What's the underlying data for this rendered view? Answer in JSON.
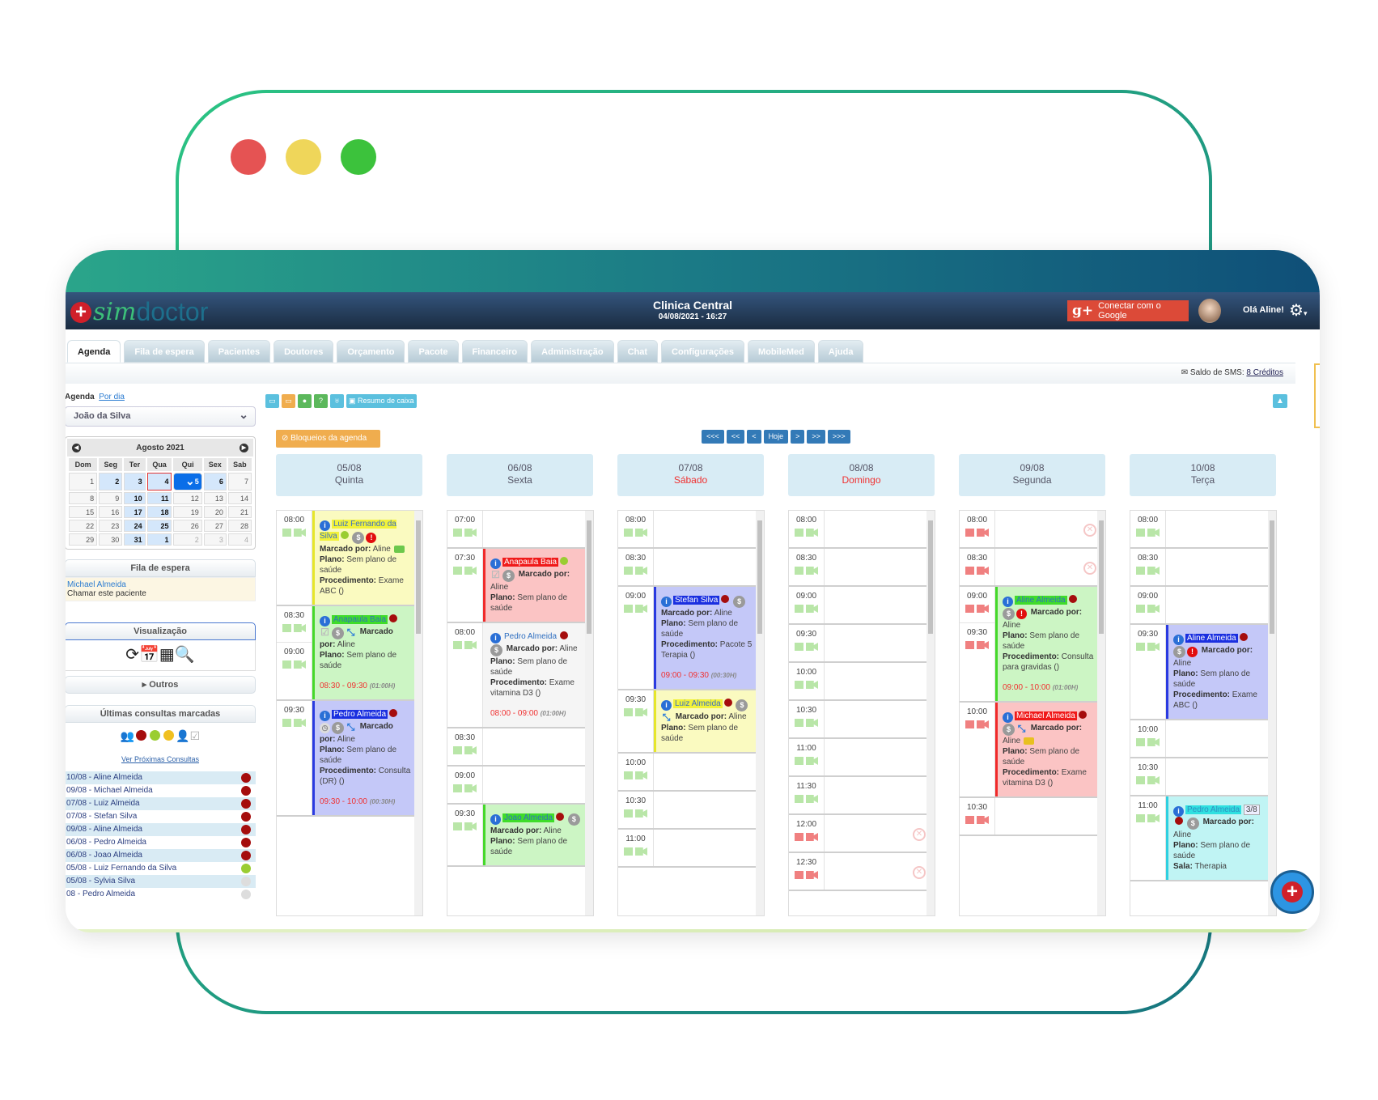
{
  "window": {
    "dots": [
      "#e55353",
      "#efd65a",
      "#3cc23c"
    ],
    "frame_colors": [
      "#2bc383",
      "#16767f"
    ]
  },
  "header": {
    "logo": "simdoctor",
    "logo_sim": "sim",
    "logo_doctor": "doctor",
    "clinic": "Clinica Central",
    "datetime": "04/08/2021 - 16:27",
    "google_button": "Conectar com o Google",
    "greeting": "Olá Aline!"
  },
  "tabs": [
    "Agenda",
    "Fila de espera",
    "Pacientes",
    "Doutores",
    "Orçamento",
    "Pacote",
    "Financeiro",
    "Administração",
    "Chat",
    "Configurações",
    "MobileMed",
    "Ajuda"
  ],
  "active_tab": "Agenda",
  "sms": {
    "label": "Saldo de SMS:",
    "value": "8 Créditos"
  },
  "sidebar": {
    "agenda_label": "Agenda",
    "por_dia": "Por dia",
    "doctor_select": "João da Silva",
    "calendar": {
      "title": "Agosto 2021",
      "weekdays": [
        "Dom",
        "Seg",
        "Ter",
        "Qua",
        "Qui",
        "Sex",
        "Sab"
      ],
      "weeks": [
        [
          "1",
          "2",
          "3",
          "4",
          "5",
          "6",
          "7"
        ],
        [
          "8",
          "9",
          "10",
          "11",
          "12",
          "13",
          "14"
        ],
        [
          "15",
          "16",
          "17",
          "18",
          "19",
          "20",
          "21"
        ],
        [
          "22",
          "23",
          "24",
          "25",
          "26",
          "27",
          "28"
        ],
        [
          "29",
          "30",
          "31",
          "1",
          "2",
          "3",
          "4"
        ]
      ],
      "highlighted": [
        "2",
        "3",
        "4",
        "6",
        "10",
        "11",
        "17",
        "18",
        "24",
        "25",
        "31"
      ],
      "selected": "5",
      "today": "4"
    },
    "fila": {
      "title": "Fila de espera",
      "patient": "Michael Almeida",
      "action": "Chamar este paciente"
    },
    "visualizacao": "Visualização",
    "view_icons": [
      "refresh-icon",
      "calendar-day-icon",
      "calendar-month-icon",
      "search-icon"
    ],
    "outros": "Outros",
    "ultimas": {
      "title": "Últimas consultas marcadas",
      "legend": [
        "group-icon",
        "red-dot",
        "green-dot",
        "yellow-dot",
        "doctor-icon",
        "check-icon"
      ],
      "ver": "Ver Próximas Consultas",
      "items": [
        {
          "text": "10/08 - Aline Almeida",
          "status": "#a50d0d"
        },
        {
          "text": "09/08 - Michael Almeida",
          "status": "#a50d0d"
        },
        {
          "text": "07/08 - Luiz Almeida",
          "status": "#a50d0d"
        },
        {
          "text": "07/08 - Stefan Silva",
          "status": "#a50d0d"
        },
        {
          "text": "09/08 - Aline Almeida",
          "status": "#a50d0d"
        },
        {
          "text": "06/08 - Pedro Almeida",
          "status": "#a50d0d"
        },
        {
          "text": "06/08 - Joao Almeida",
          "status": "#a50d0d"
        },
        {
          "text": "05/08 - Luiz Fernando da Silva",
          "status": "#9acd32"
        },
        {
          "text": "05/08 - Sylvia Silva",
          "status": "#dddddd"
        },
        {
          "text": "08 - Pedro Almeida",
          "status": "#dddddd"
        }
      ]
    }
  },
  "toolbar": {
    "buttons": [
      {
        "icon": "calendar-icon",
        "color": "#5bc0de"
      },
      {
        "icon": "monitor-icon",
        "color": "#f0ad4e"
      },
      {
        "icon": "chat-icon",
        "color": "#5cb85c"
      },
      {
        "icon": "help-icon",
        "color": "#5cb85c"
      },
      {
        "icon": "stethoscope-icon",
        "color": "#5bc0de"
      }
    ],
    "resumo": "Resumo de caixa",
    "bloqueios": "Bloqueios da agenda",
    "nav": [
      "<<<",
      "<<",
      "<",
      "Hoje",
      ">",
      ">>",
      ">>>"
    ]
  },
  "labels": {
    "marcado": "Marcado por:",
    "plano": "Plano:",
    "procedimento": "Procedimento:",
    "sala": "Sala:"
  },
  "days": [
    {
      "date": "05/08",
      "weekday": "Quinta",
      "weekend": false,
      "slot_icon_color": "#b9e6a8",
      "blocks": [
        {
          "times": [
            "08:00"
          ],
          "event": {
            "name": "Luiz Fernando da Silva",
            "name_bg": "#f2f23a",
            "name_color": "#3a6fc4",
            "bg": "#fafac0",
            "border": "#e6e62a",
            "dot": "#9acd32",
            "icons": [
              "money",
              "alert"
            ],
            "marcado": "Aline",
            "plano": "Sem plano de saúde",
            "procedimento": "Exame ABC ()",
            "video": "#6cc84c"
          }
        },
        {
          "times": [
            "08:30",
            "09:00"
          ],
          "event": {
            "name": "Anapaula Baia",
            "name_bg": "#3fdc2a",
            "name_color": "#2f6fc0",
            "bg": "#ccf5c4",
            "border": "#45d82a",
            "dot": "#a50d0d",
            "icons": [
              "checkin",
              "money",
              "compress"
            ],
            "marcado": "Aline",
            "plano": "Sem plano de saúde",
            "time_range": "08:30 - 09:30",
            "duration": "(01:00H)"
          }
        },
        {
          "times": [
            "09:30"
          ],
          "event": {
            "name": "Pedro Almeida",
            "name_bg": "#1a2fe0",
            "name_color": "#ffffff",
            "bg": "#c4c8f8",
            "border": "#2a3ae0",
            "dot": "#a50d0d",
            "icons": [
              "clock",
              "money",
              "compress"
            ],
            "marcado": "Aline",
            "plano": "Sem plano de saúde",
            "procedimento": "Consulta (DR) ()",
            "time_range": "09:30 - 10:00",
            "duration": "(00:30H)"
          }
        }
      ]
    },
    {
      "date": "06/08",
      "weekday": "Sexta",
      "weekend": false,
      "slot_icon_color": "#b9e6a8",
      "blocks": [
        {
          "times": [
            "07:00"
          ]
        },
        {
          "times": [
            "07:30"
          ],
          "event": {
            "name": "Anapaula Baia",
            "name_bg": "#f01a1a",
            "name_color": "#ffffff",
            "bg": "#fbc4c4",
            "border": "#f02a2a",
            "dot": "#9acd32",
            "icons": [
              "checkin",
              "money"
            ],
            "marcado": "Aline",
            "plano": "Sem plano de saúde"
          }
        },
        {
          "times": [
            "08:00"
          ],
          "event": {
            "name": "Pedro Almeida",
            "name_bg": "transparent",
            "name_color": "#2f6fc0",
            "bg": "#f5f5f5",
            "border": "transparent",
            "dot": "#a50d0d",
            "icons": [
              "money"
            ],
            "marcado": "Aline",
            "plano": "Sem plano de saúde",
            "procedimento": "Exame vitamina D3 ()",
            "time_range": "08:00 - 09:00",
            "duration": "(01:00H)"
          }
        },
        {
          "times": [
            "08:30"
          ]
        },
        {
          "times": [
            "09:00"
          ]
        },
        {
          "times": [
            "09:30"
          ],
          "event": {
            "name": "Joao Almeida",
            "name_bg": "#3fdc2a",
            "name_color": "#2f6fc0",
            "bg": "#ccf5c4",
            "border": "#45d82a",
            "dot": "#a50d0d",
            "icons": [
              "money"
            ],
            "marcado": "Aline",
            "plano": "Sem plano de saúde"
          }
        }
      ]
    },
    {
      "date": "07/08",
      "weekday": "Sábado",
      "weekend": true,
      "slot_icon_color": "#b9e6a8",
      "blocks": [
        {
          "times": [
            "08:00"
          ]
        },
        {
          "times": [
            "08:30"
          ]
        },
        {
          "times": [
            "09:00"
          ],
          "event": {
            "name": "Stefan Silva",
            "name_bg": "#1a2fe0",
            "name_color": "#ffffff",
            "bg": "#c4c8f8",
            "border": "#2a3ae0",
            "dot": "#a50d0d",
            "icons": [
              "money"
            ],
            "marcado": "Aline",
            "plano": "Sem plano de saúde",
            "procedimento": "Pacote 5 Terapia ()",
            "time_range": "09:00 - 09:30",
            "duration": "(00:30H)"
          }
        },
        {
          "times": [
            "09:30"
          ],
          "event": {
            "name": "Luiz Almeida",
            "name_bg": "#f2f23a",
            "name_color": "#3a6fc4",
            "bg": "#fafac0",
            "border": "#e6e62a",
            "dot": "#a50d0d",
            "icons": [
              "money",
              "compress"
            ],
            "marcado": "Aline",
            "plano": "Sem plano de saúde"
          }
        },
        {
          "times": [
            "10:00"
          ]
        },
        {
          "times": [
            "10:30"
          ]
        },
        {
          "times": [
            "11:00"
          ]
        }
      ]
    },
    {
      "date": "08/08",
      "weekday": "Domingo",
      "weekend": true,
      "slot_icon_color": "#b9e6a8",
      "blocks": [
        {
          "times": [
            "08:00"
          ]
        },
        {
          "times": [
            "08:30"
          ]
        },
        {
          "times": [
            "09:00"
          ]
        },
        {
          "times": [
            "09:30"
          ]
        },
        {
          "times": [
            "10:00"
          ]
        },
        {
          "times": [
            "10:30"
          ]
        },
        {
          "times": [
            "11:00"
          ]
        },
        {
          "times": [
            "11:30"
          ]
        },
        {
          "times": [
            "12:00"
          ],
          "blocked": true,
          "slot_icon_color": "#f08080"
        },
        {
          "times": [
            "12:30"
          ],
          "blocked": true,
          "slot_icon_color": "#f08080"
        }
      ]
    },
    {
      "date": "09/08",
      "weekday": "Segunda",
      "weekend": false,
      "slot_icon_color": "#f08080",
      "blocks": [
        {
          "times": [
            "08:00"
          ],
          "blocked": true
        },
        {
          "times": [
            "08:30"
          ],
          "blocked": true
        },
        {
          "times": [
            "09:00",
            "09:30"
          ],
          "event": {
            "name": "Aline Almeida",
            "name_bg": "#3fdc2a",
            "name_color": "#2f6fc0",
            "bg": "#ccf5c4",
            "border": "#45d82a",
            "dot": "#a50d0d",
            "icons": [
              "money",
              "alert"
            ],
            "marcado": "Aline",
            "plano": "Sem plano de saúde",
            "procedimento": "Consulta para gravidas ()",
            "time_range": "09:00 - 10:00",
            "duration": "(01:00H)"
          }
        },
        {
          "times": [
            "10:00"
          ],
          "event": {
            "name": "Michael Almeida",
            "name_bg": "#f01a1a",
            "name_color": "#ffffff",
            "bg": "#fbc4c4",
            "border": "#f02a2a",
            "dot": "#a50d0d",
            "icons": [
              "money",
              "compress"
            ],
            "marcado": "Aline",
            "plano": "Sem plano de saúde",
            "procedimento": "Exame vitamina D3 ()",
            "video": "#e8c020"
          }
        },
        {
          "times": [
            "10:30"
          ]
        }
      ]
    },
    {
      "date": "10/08",
      "weekday": "Terça",
      "weekend": false,
      "slot_icon_color": "#b9e6a8",
      "blocks": [
        {
          "times": [
            "08:00"
          ]
        },
        {
          "times": [
            "08:30"
          ]
        },
        {
          "times": [
            "09:00"
          ]
        },
        {
          "times": [
            "09:30"
          ],
          "event": {
            "name": "Aline Almeida",
            "name_bg": "#1a2fe0",
            "name_color": "#ffffff",
            "bg": "#c4c8f8",
            "border": "#2a3ae0",
            "dot": "#a50d0d",
            "icons": [
              "money",
              "alert"
            ],
            "marcado": "Aline",
            "plano": "Sem plano de saúde",
            "procedimento": "Exame ABC ()"
          }
        },
        {
          "times": [
            "10:00"
          ]
        },
        {
          "times": [
            "10:30"
          ]
        },
        {
          "times": [
            "11:00"
          ],
          "event": {
            "name": "Pedro Almeida",
            "badge": "3/8",
            "name_bg": "#2fe0e0",
            "name_color": "#2f8fc0",
            "bg": "#c0f4f4",
            "border": "#2fd0e0",
            "dot": "#a50d0d",
            "icons": [
              "money"
            ],
            "marcado": "Aline",
            "plano": "Sem plano de saúde",
            "sala": "Therapia"
          }
        }
      ]
    }
  ]
}
